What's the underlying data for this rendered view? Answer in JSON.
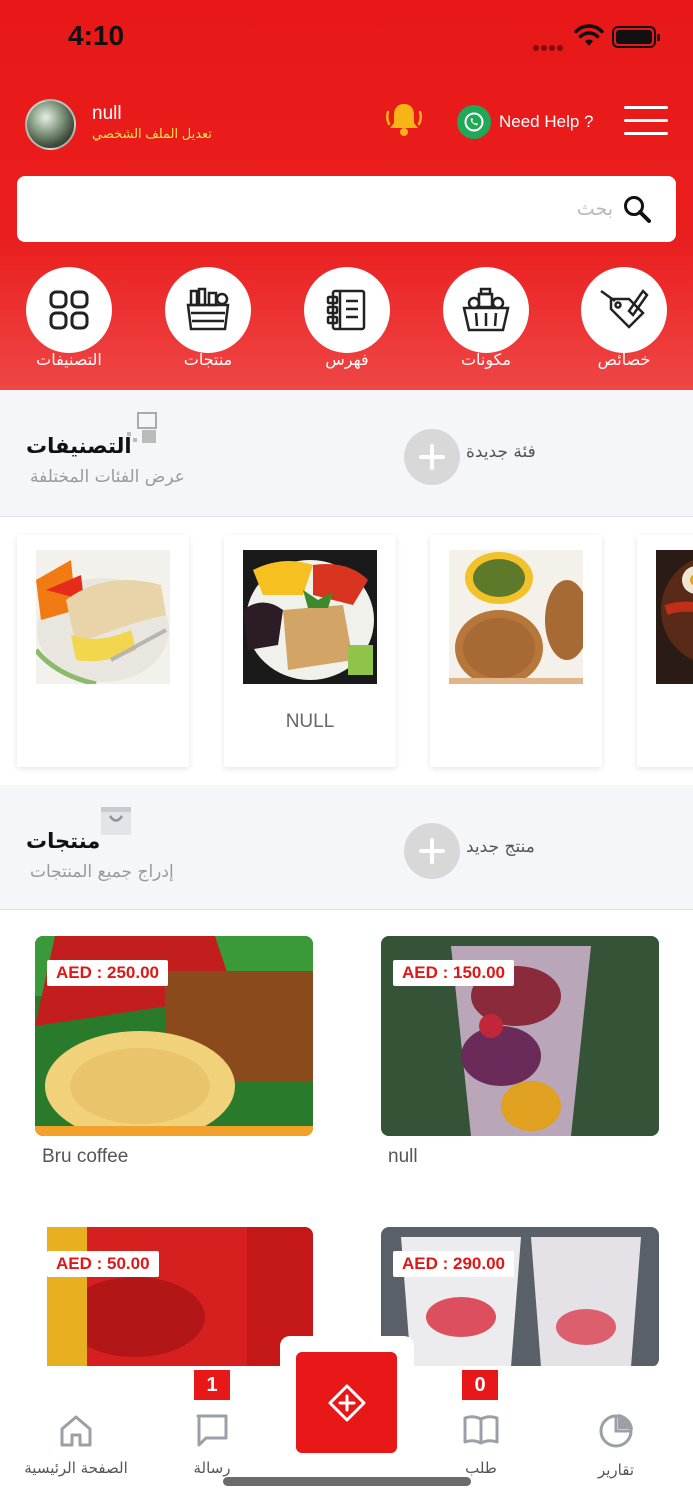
{
  "status": {
    "time": "4:10"
  },
  "profile": {
    "name": "null",
    "edit_label": "تعديل الملف الشخصي"
  },
  "header": {
    "help_label": "Need Help ?"
  },
  "search": {
    "placeholder": "بحث"
  },
  "quick_actions": [
    {
      "label": "التصنيفات",
      "icon": "categories-grid-icon"
    },
    {
      "label": "منتجات",
      "icon": "products-basket-icon"
    },
    {
      "label": "فهرس",
      "icon": "catalog-book-icon"
    },
    {
      "label": "مكونات",
      "icon": "ingredients-basket-icon"
    },
    {
      "label": "خصائص",
      "icon": "attributes-tag-icon"
    }
  ],
  "categories_section": {
    "title": "التصنيفات",
    "subtitle": "عرض الفئات المختلفة",
    "add_label": "فئة جديدة",
    "items": [
      {
        "name": ""
      },
      {
        "name": "NULL"
      },
      {
        "name": ""
      },
      {
        "name": ""
      }
    ]
  },
  "products_section": {
    "title": "منتجات",
    "subtitle": "إدراج جميع المنتجات",
    "add_label": "منتج جديد",
    "items": [
      {
        "name": "Bru coffee",
        "price": "AED : 250.00"
      },
      {
        "name": "null",
        "price": "AED : 150.00"
      },
      {
        "name": "",
        "price": "AED : 50.00"
      },
      {
        "name": "",
        "price": "AED : 290.00"
      }
    ]
  },
  "bottom_nav": {
    "home": "الصفحة الرئيسية",
    "messages": "رسالة",
    "messages_badge": "1",
    "orders": "طلب",
    "orders_badge": "0",
    "reports": "تقارير"
  },
  "colors": {
    "brand": "#e81818",
    "badge_text": "#ffe04a"
  }
}
